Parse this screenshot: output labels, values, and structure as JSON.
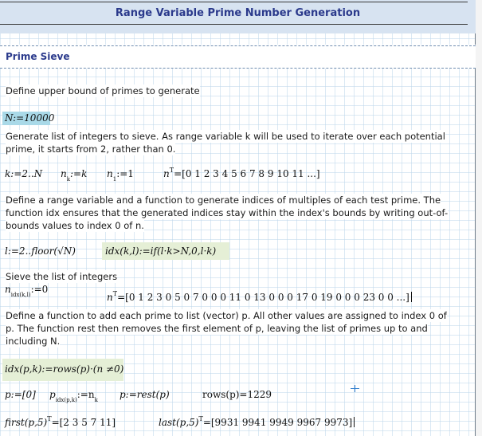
{
  "header": {
    "title": "Range Variable Prime Number Generation"
  },
  "section": {
    "title": "Prime Sieve"
  },
  "paragraphs": {
    "p1": "Define upper bound of primes to generate",
    "p2a": "Generate list of integers to sieve.  As range variable k will be used to iterate over each potential",
    "p2b": "prime, it starts from 2, rather than 0.",
    "p3a": "Define a range variable and a function to generate indices of multiples of each test prime.  The",
    "p3b": "function idx ensures that the generated indices stay within the index's bounds by writing out-of-",
    "p3c": "bounds values to index 0 of n.",
    "p4": "Sieve the list of integers",
    "p5a": "Define a function to add each prime to list (vector) p.  All other values are assigned to index 0 of",
    "p5b": "p. The function rest then removes the first element of p, leaving the list of primes up to and",
    "p5c": "including N."
  },
  "math": {
    "N_def": "N:=10000",
    "k_def": "k:=2..N",
    "nk_lhs": "n",
    "nk_sub": "k",
    "nk_rhs": ":=k",
    "n1_lhs": "n",
    "n1_sub": "1",
    "n1_rhs": ":=1",
    "nT_lhs": "n",
    "nT_sup": "T",
    "nT_eq": "=",
    "nT_val": "[0  1  2  3  4  5  6  7  8  9  10  11  ...]",
    "l_def": "l:=2..floor(√N)",
    "idx_def": "idx(k,l):=if(l·k>N,0,l·k)",
    "sieve_lhs": "n",
    "sieve_sub": "idx(k,l)",
    "sieve_rhs": ":=0",
    "nT2_lhs": "n",
    "nT2_sup": "T",
    "nT2_eq": "=",
    "nT2_val": "[0  1  2  3  0  5  0  7  0  0  0  11  0  13  0  0  0  17  0  19  0  0  0  23  0  0  ...]",
    "idxpk_def": "idx(p,k):=rows(p)·(n  ≠0)",
    "idxpk_sub": "k",
    "p_def": "p:=[0]",
    "pidx_lhs": "p",
    "pidx_sub": "idx(p,k)",
    "pidx_rhs": ":=n",
    "pidx_rsub": "k",
    "prest_def": "p:=rest(p)",
    "rows_eval": "rows(p)=1229",
    "first_lhs": "first(p,5)",
    "first_sup": "T",
    "first_val": "=[2  3  5  7  11]",
    "last_lhs": "last(p,5)",
    "last_sup": "T",
    "last_val": "=[9931  9941  9949  9967  9973]"
  },
  "colors": {
    "title_band": "#d7e3f1",
    "title_text": "#2b3a8c",
    "highlight_blue": "#a9d9e8",
    "highlight_green": "#e5efd6",
    "grid": "#bed7eb"
  },
  "icons": {
    "cursor": "crosshair-cursor-icon"
  }
}
